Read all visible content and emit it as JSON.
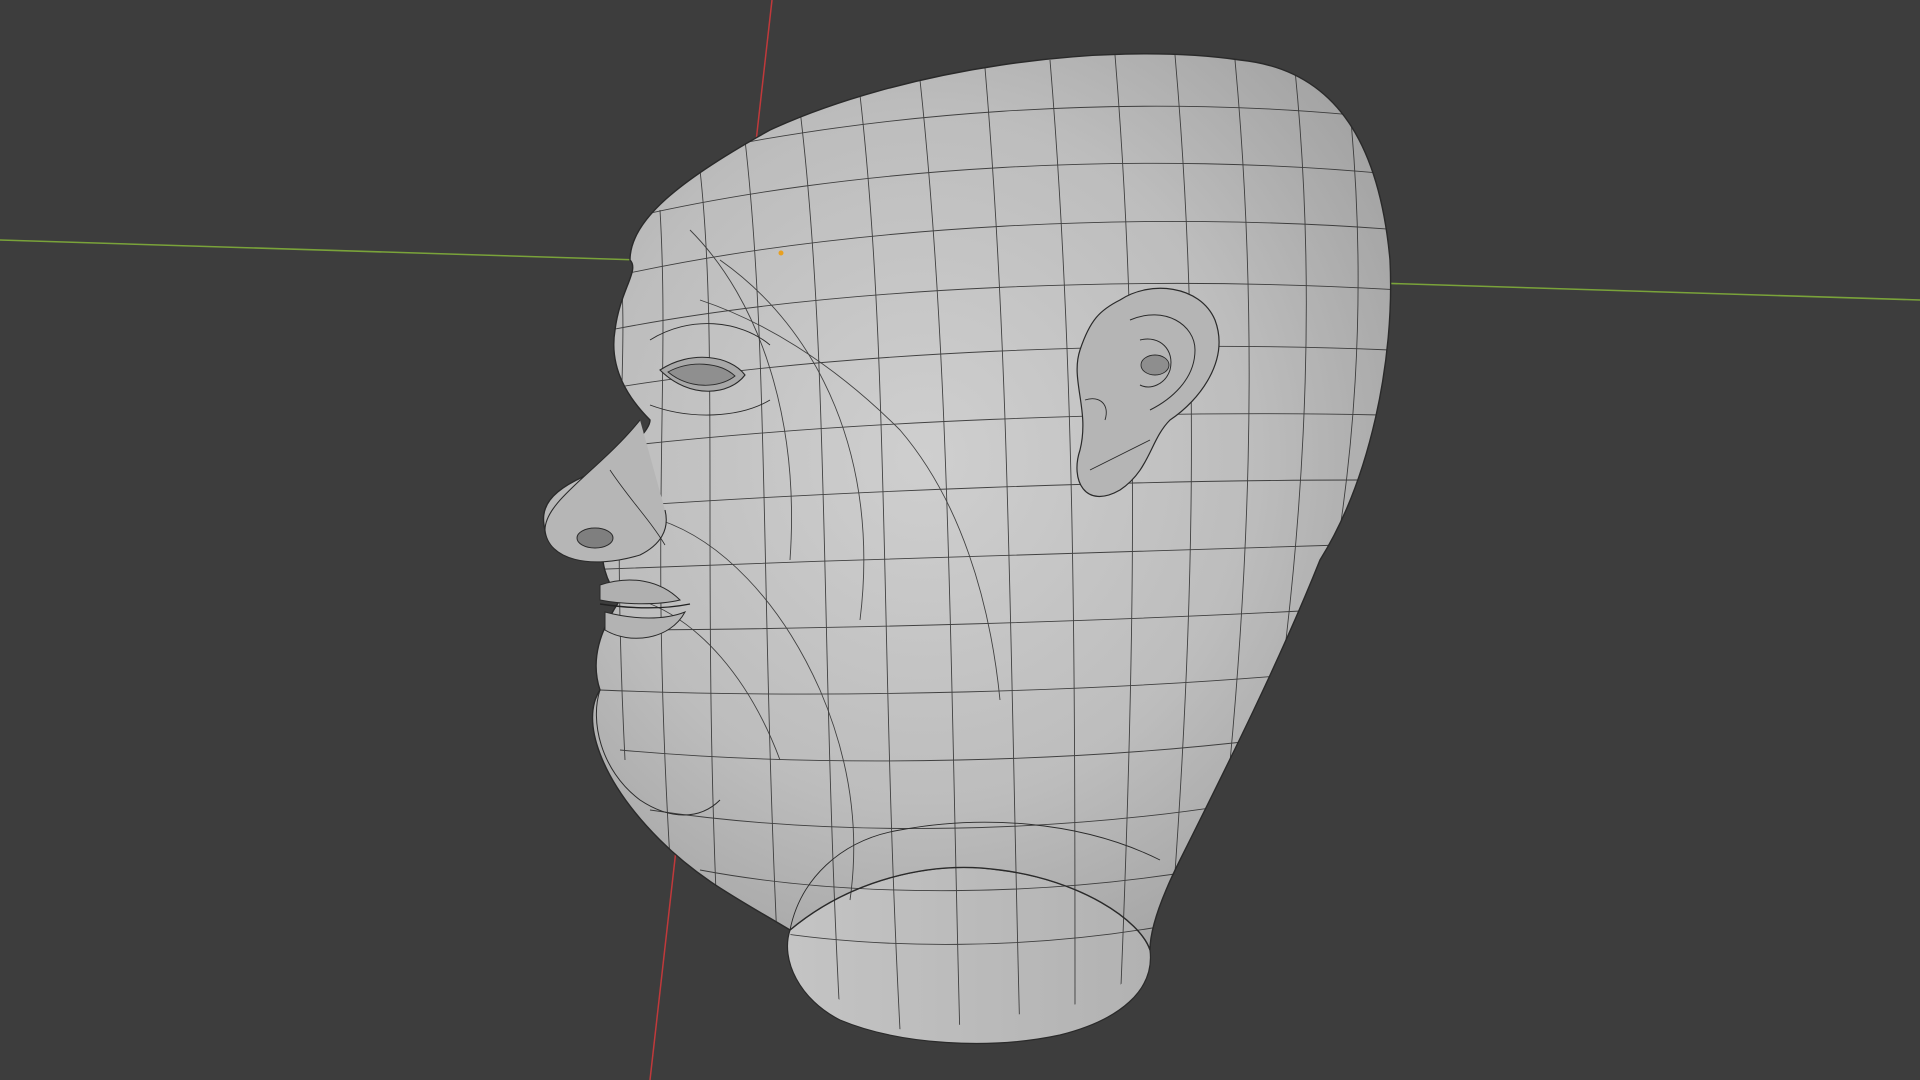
{
  "viewport": {
    "background_color": "#3d3d3d",
    "x_axis_color": "#c0393b",
    "y_axis_color": "#7aa33a",
    "mesh_color": "#b8b8b8",
    "wire_color": "#2a2a2a",
    "origin_color": "#e8a020"
  },
  "scene": {
    "object": "head-mesh",
    "shading": "solid",
    "overlay": "wireframe"
  }
}
